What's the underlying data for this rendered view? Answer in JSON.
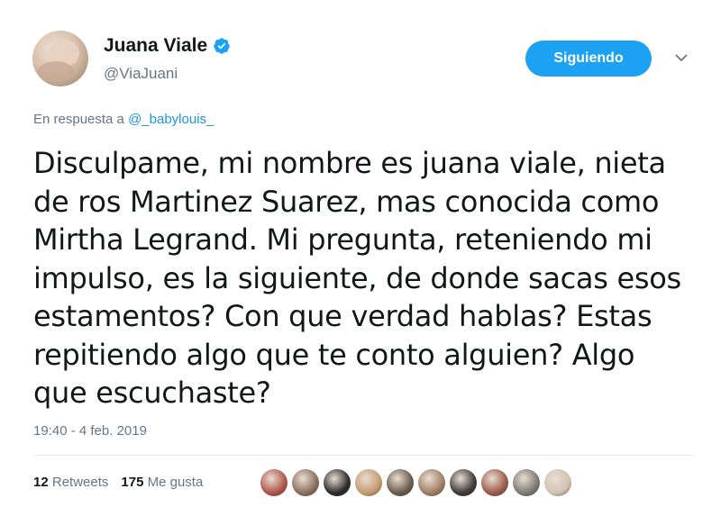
{
  "author": {
    "display_name": "Juana Viale",
    "handle": "@ViaJuani",
    "verified_icon": "verified-badge-icon"
  },
  "follow_button": {
    "label": "Siguiendo"
  },
  "menu_caret": {
    "icon": "chevron-down-icon"
  },
  "reply": {
    "prefix": "En respuesta a",
    "to_handle": "@_babylouis_"
  },
  "tweet": {
    "lines": [
      "Disculpame, mi nombre es juana viale, nieta",
      "de ros Martinez Suarez, mas conocida como",
      "Mirtha Legrand. Mi pregunta, reteniendo mi",
      "impulso, es la siguiente, de donde sacas esos",
      "estamentos? Con que verdad hablas? Estas",
      "repitiendo algo que te conto alguien? Algo",
      "que escuchaste?"
    ]
  },
  "timestamp": "19:40 - 4 feb. 2019",
  "stats": {
    "retweets_count": "12",
    "retweets_label": "Retweets",
    "likes_count": "175",
    "likes_label": "Me gusta"
  },
  "colors": {
    "accent": "#1da1f2",
    "link": "#1b95e0",
    "muted": "#657786",
    "text": "#14171a"
  },
  "likers": [
    {
      "color": "#b0554a"
    },
    {
      "color": "#8a6f5c"
    },
    {
      "color": "#2b2b2b"
    },
    {
      "color": "#c79a6e"
    },
    {
      "color": "#6b5a4e"
    },
    {
      "color": "#a07d63"
    },
    {
      "color": "#3d3a38"
    },
    {
      "color": "#9b5b49"
    },
    {
      "color": "#7d7a72"
    },
    {
      "color": "#d2c2b2"
    }
  ]
}
